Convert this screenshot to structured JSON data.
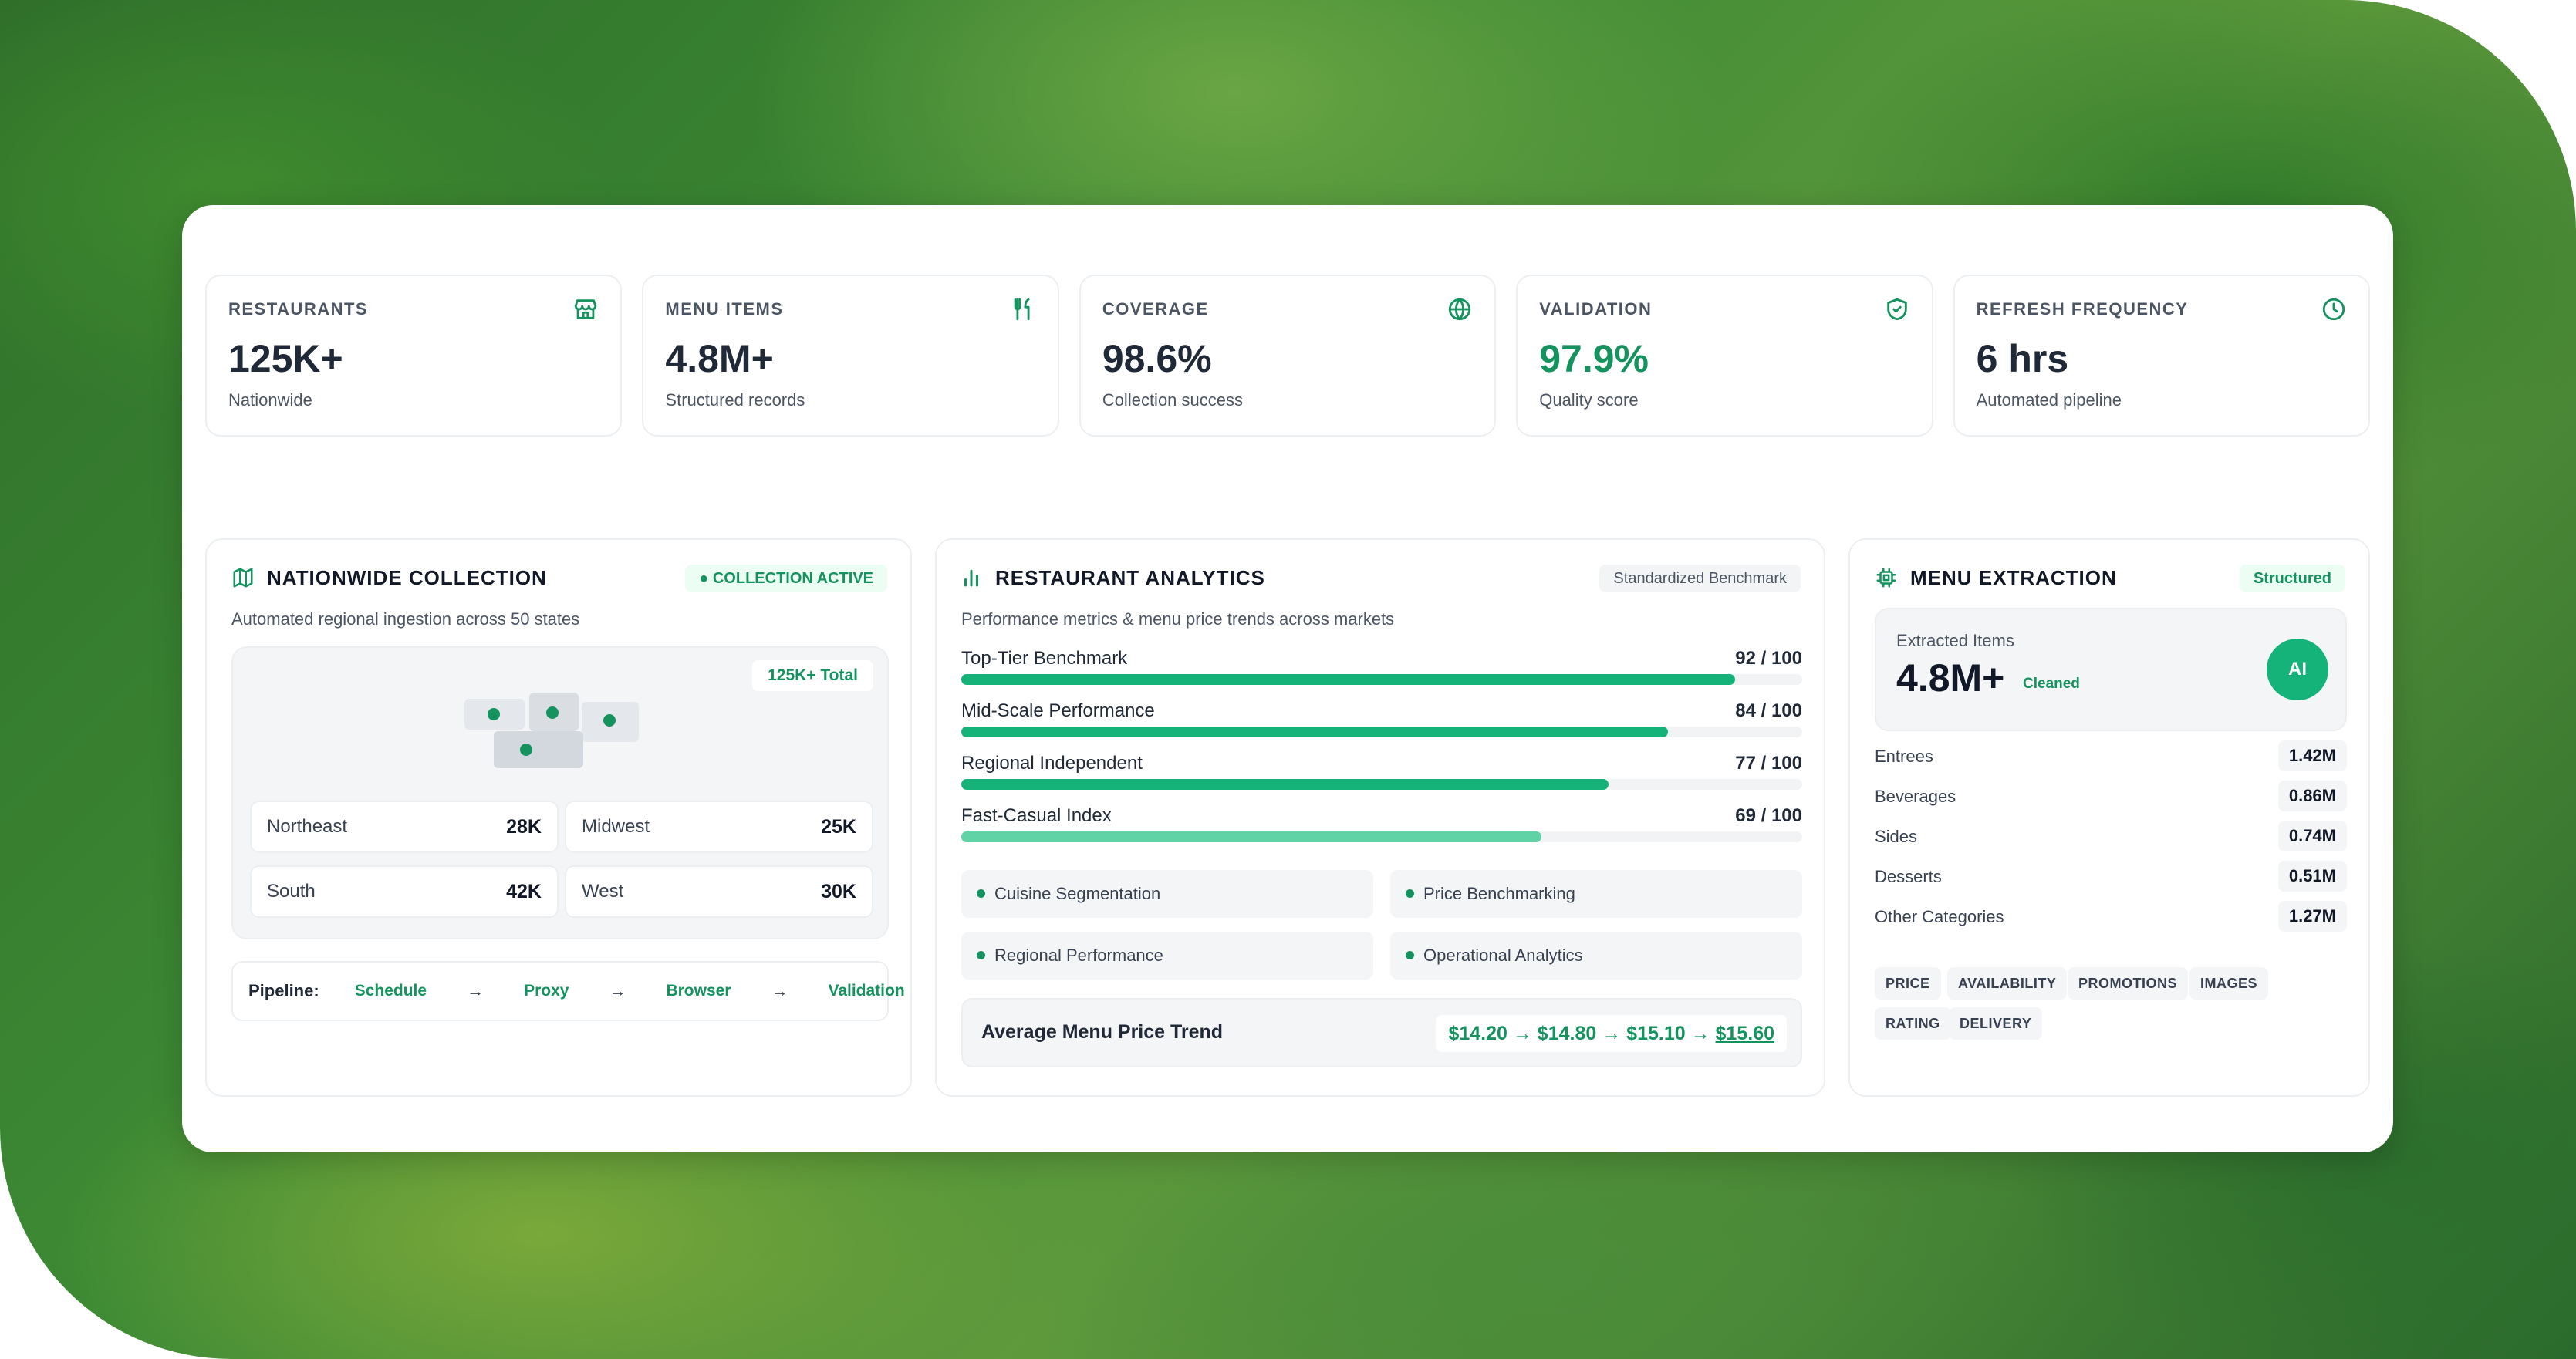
{
  "stats": [
    {
      "label": "RESTAURANTS",
      "value": "125K+",
      "sub": "Nationwide",
      "icon": "store-icon"
    },
    {
      "label": "MENU ITEMS",
      "value": "4.8M+",
      "sub": "Structured records",
      "icon": "utensils-icon"
    },
    {
      "label": "COVERAGE",
      "value": "98.6%",
      "sub": "Collection success",
      "icon": "globe-icon"
    },
    {
      "label": "VALIDATION",
      "value": "97.9%",
      "sub": "Quality score",
      "icon": "shield-check-icon"
    },
    {
      "label": "REFRESH FREQUENCY",
      "value": "6 hrs",
      "sub": "Automated pipeline",
      "icon": "clock-icon"
    }
  ],
  "nationwide": {
    "title": "NATIONWIDE COLLECTION",
    "status": "● COLLECTION ACTIVE",
    "subtitle": "Automated regional ingestion across 50 states",
    "total": "125K+ Total",
    "regions": [
      {
        "name": "Northeast",
        "value": "28K"
      },
      {
        "name": "Midwest",
        "value": "25K"
      },
      {
        "name": "South",
        "value": "42K"
      },
      {
        "name": "West",
        "value": "30K"
      }
    ],
    "pipeline_label": "Pipeline:",
    "pipeline_steps": [
      "Schedule",
      "Proxy",
      "Browser",
      "Validation"
    ],
    "arrow": "→"
  },
  "analytics": {
    "title": "RESTAURANT ANALYTICS",
    "badge": "Standardized Benchmark",
    "subtitle": "Performance metrics & menu price trends across markets",
    "bars": [
      {
        "label": "Top-Tier Benchmark",
        "score": "92 / 100",
        "value": 92,
        "color": "#15b37a"
      },
      {
        "label": "Mid-Scale Performance",
        "score": "84 / 100",
        "value": 84,
        "color": "#15b37a"
      },
      {
        "label": "Regional Independent",
        "score": "77 / 100",
        "value": 77,
        "color": "#15b37a"
      },
      {
        "label": "Fast-Casual Index",
        "score": "69 / 100",
        "value": 69,
        "color": "#5fd3a6"
      }
    ],
    "tags": [
      "Cuisine Segmentation",
      "Price Benchmarking",
      "Regional Performance",
      "Operational Analytics"
    ],
    "trend_label": "Average Menu Price Trend",
    "trend_values": "$14.20 → $14.80 → $15.10 → ",
    "trend_last": "$15.60"
  },
  "extraction": {
    "title": "MENU EXTRACTION",
    "badge": "Structured",
    "box_label": "Extracted Items",
    "box_value": "4.8M+",
    "box_tag": "Cleaned",
    "ai": "AI",
    "categories": [
      {
        "name": "Entrees",
        "value": "1.42M"
      },
      {
        "name": "Beverages",
        "value": "0.86M"
      },
      {
        "name": "Sides",
        "value": "0.74M"
      },
      {
        "name": "Desserts",
        "value": "0.51M"
      },
      {
        "name": "Other Categories",
        "value": "1.27M"
      }
    ],
    "chips": [
      "PRICE",
      "AVAILABILITY",
      "PROMOTIONS",
      "IMAGES",
      "RATING",
      "DELIVERY"
    ]
  },
  "colors": {
    "accent": "#15935f",
    "accent_bar": "#15b37a",
    "accent_light": "#5fd3a6"
  }
}
